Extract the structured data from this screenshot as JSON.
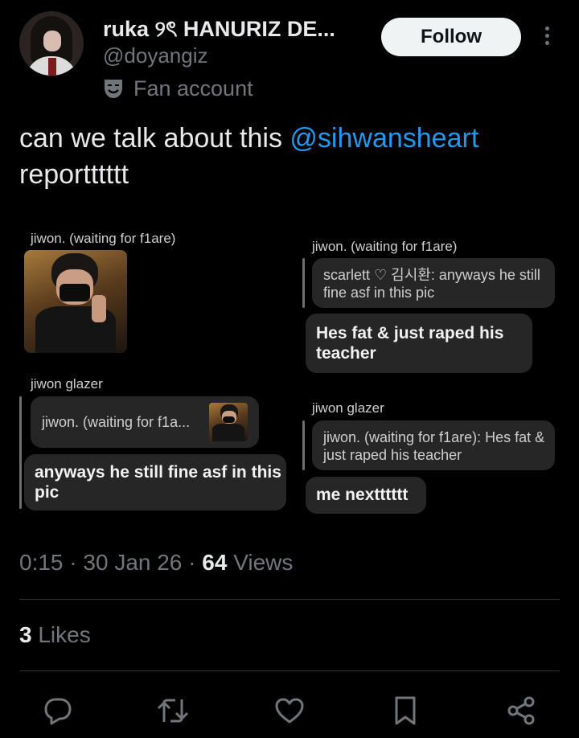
{
  "header": {
    "display_name": "ruka ୨ৎ HANURIZ DE...",
    "handle": "@doyangiz",
    "account_label": "Fan account",
    "follow_label": "Follow"
  },
  "tweet": {
    "text_before": "can we talk about this ",
    "mention": "@sihwansheart",
    "text_after": "reportttttt"
  },
  "screenshot": {
    "left": {
      "sender1": "jiwon. (waiting for f1are)",
      "sender2": "jiwon glazer",
      "reply_quote": "jiwon. (waiting for f1a...",
      "message": "anyways he still fine asf in this pic"
    },
    "right": {
      "sender1": "jiwon. (waiting for f1are)",
      "quote1": "scarlett ♡ 김시환: anyways he still fine asf in this pic",
      "message1": "Hes fat & just raped his teacher",
      "sender2": "jiwon glazer",
      "quote2": "jiwon. (waiting for f1are): Hes fat & just raped his teacher",
      "message2": "me nextttttt"
    }
  },
  "meta": {
    "time": "0:15",
    "sep1": " · ",
    "date": "30 Jan 26",
    "sep2": " · ",
    "views_count": "64",
    "views_label": " Views"
  },
  "likes": {
    "count": "3",
    "label": " Likes"
  },
  "actions": [
    "reply-icon",
    "retweet-icon",
    "like-icon",
    "bookmark-icon",
    "share-icon"
  ],
  "colors": {
    "accent": "#1d9bf0",
    "secondary_text": "#71767b",
    "bubble": "#262626"
  }
}
